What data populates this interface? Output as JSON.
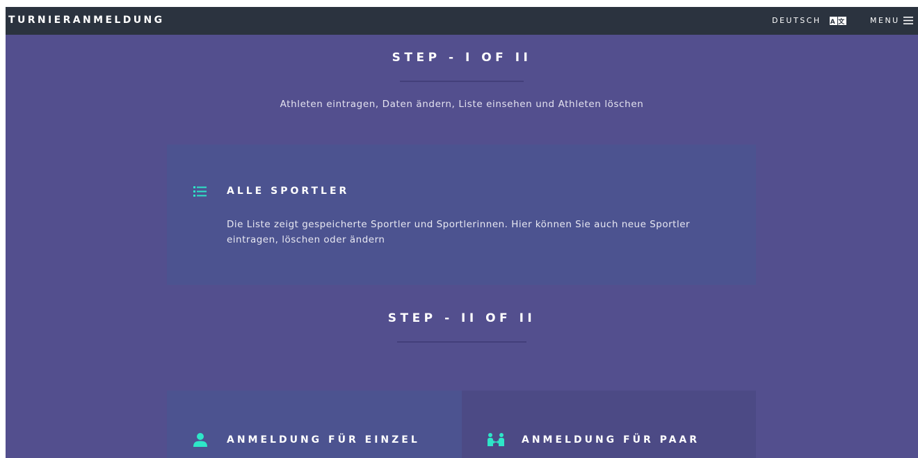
{
  "header": {
    "brand": "TURNIERANMELDUNG",
    "language_label": "DEUTSCH",
    "menu_label": "MENU"
  },
  "step1": {
    "title": "STEP - I OF II",
    "subtitle": "Athleten eintragen, Daten ändern, Liste einsehen und Athleten löschen",
    "card": {
      "icon": "list-icon",
      "title": "ALLE SPORTLER",
      "text_line1": "Die Liste zeigt gespeicherte Sportler und Sportlerinnen. Hier können Sie auch neue Sportler",
      "text_line2": "eintragen, löschen oder ändern"
    }
  },
  "step2": {
    "title": "STEP - II OF II",
    "cards": [
      {
        "icon": "person-icon",
        "title": "ANMELDUNG FÜR EINZEL"
      },
      {
        "icon": "pair-icon",
        "title": "ANMELDUNG FÜR PAAR"
      }
    ]
  },
  "colors": {
    "background": "#534f8e",
    "topbar": "#2b333f",
    "accent": "#2ee6c8",
    "card": "#4c5390",
    "card_alt": "#4c4a85"
  }
}
